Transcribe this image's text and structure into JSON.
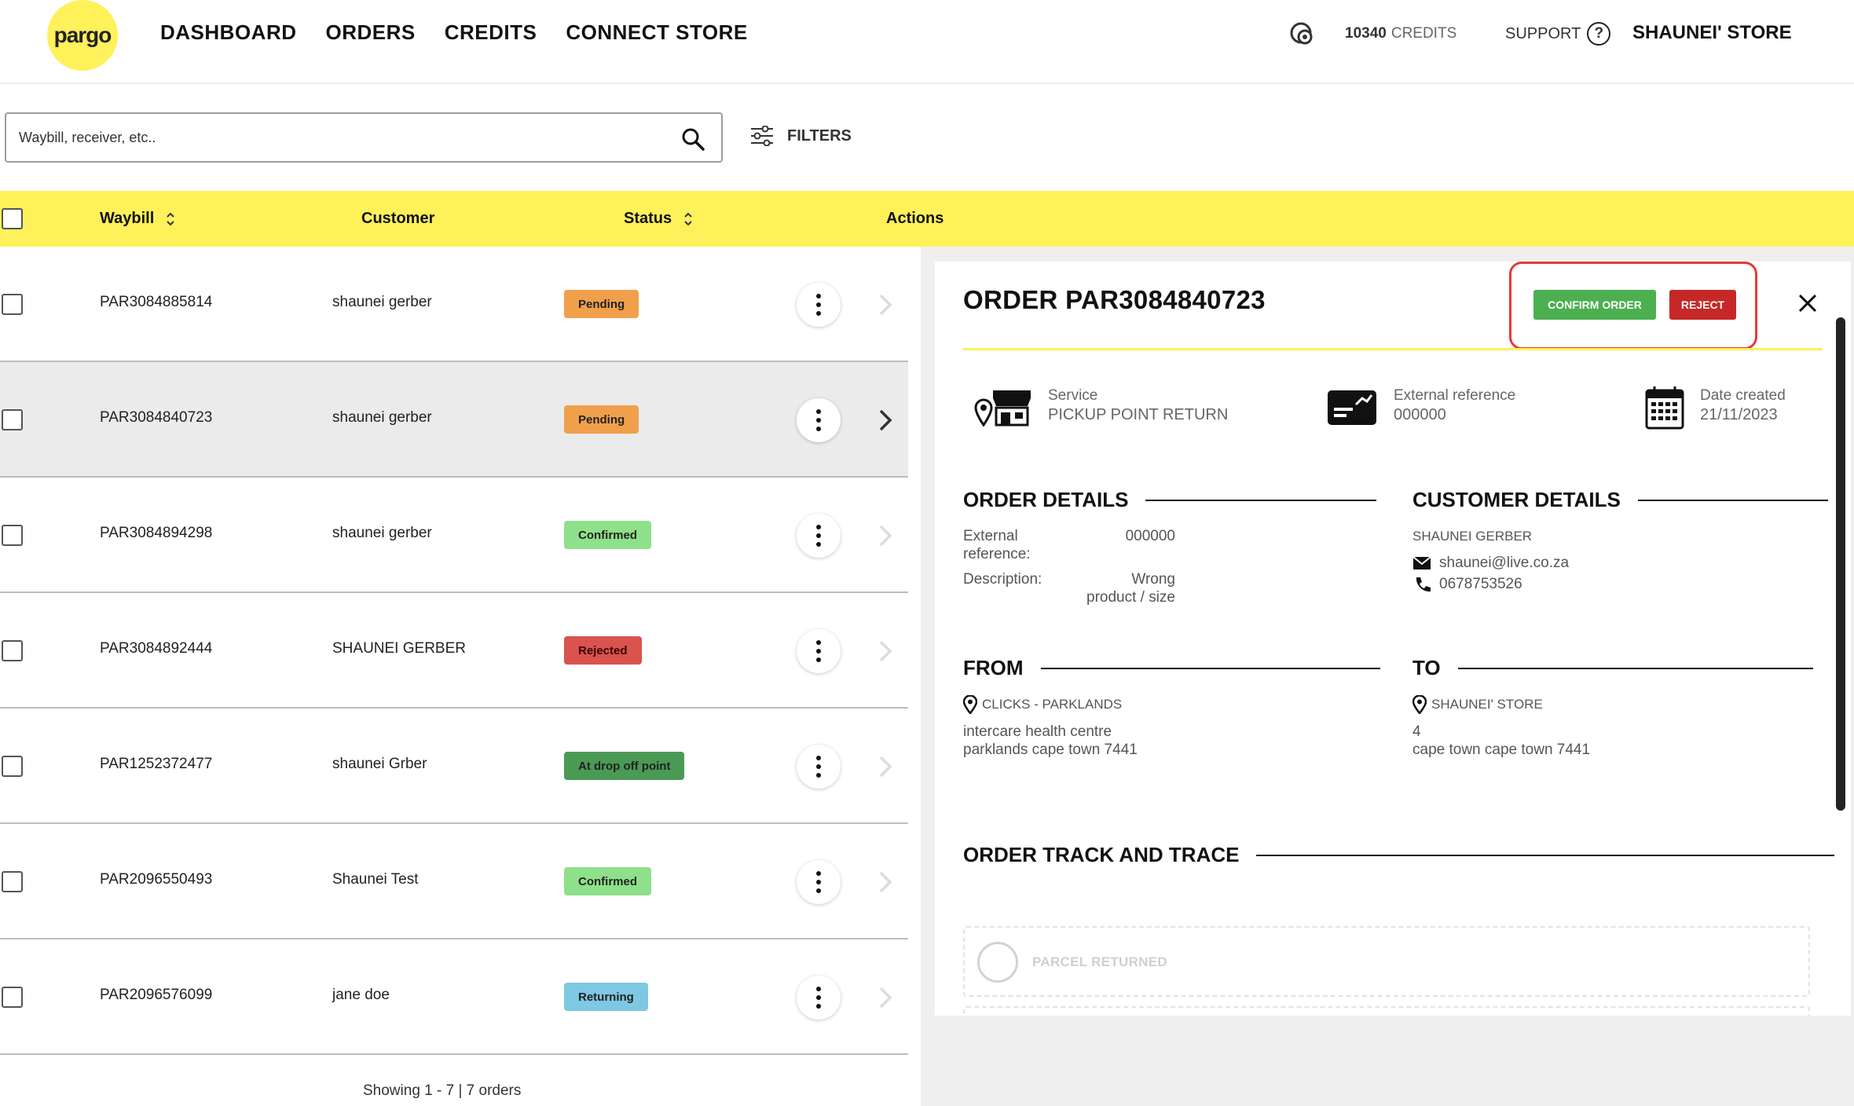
{
  "header": {
    "logo_text": "pargo",
    "nav": [
      "DASHBOARD",
      "ORDERS",
      "CREDITS",
      "CONNECT STORE"
    ],
    "credits_value": "10340",
    "credits_label": "CREDITS",
    "support_label": "SUPPORT",
    "store_name": "SHAUNEI' STORE",
    "brand_color": "#fff15a"
  },
  "search": {
    "placeholder": "Waybill, receiver, etc..",
    "filters_label": "FILTERS"
  },
  "table": {
    "columns": {
      "waybill": "Waybill",
      "customer": "Customer",
      "status": "Status",
      "actions": "Actions"
    },
    "rows": [
      {
        "waybill": "PAR3084885814",
        "customer": "shaunei gerber",
        "status": "Pending",
        "status_color": "#f0a04b",
        "selected": false
      },
      {
        "waybill": "PAR3084840723",
        "customer": "shaunei gerber",
        "status": "Pending",
        "status_color": "#f0a04b",
        "selected": true
      },
      {
        "waybill": "PAR3084894298",
        "customer": "shaunei gerber",
        "status": "Confirmed",
        "status_color": "#8fe08a",
        "selected": false
      },
      {
        "waybill": "PAR3084892444",
        "customer": "SHAUNEI GERBER",
        "status": "Rejected",
        "status_color": "#d9534f",
        "selected": false
      },
      {
        "waybill": "PAR1252372477",
        "customer": "shaunei Grber",
        "status": "At drop off point",
        "status_color": "#4a9a55",
        "selected": false
      },
      {
        "waybill": "PAR2096550493",
        "customer": "Shaunei Test",
        "status": "Confirmed",
        "status_color": "#8fe08a",
        "selected": false
      },
      {
        "waybill": "PAR2096576099",
        "customer": "jane doe",
        "status": "Returning",
        "status_color": "#7ec8e3",
        "selected": false
      }
    ],
    "footer": "Showing 1 - 7 | 7 orders"
  },
  "detail": {
    "title": "ORDER PAR3084840723",
    "confirm_label": "CONFIRM ORDER",
    "reject_label": "REJECT",
    "service_label": "Service",
    "service_value": "PICKUP POINT RETURN",
    "extref_label": "External reference",
    "extref_value": "000000",
    "date_label": "Date created",
    "date_value": "21/11/2023",
    "order_details": {
      "heading": "ORDER DETAILS",
      "extref_key_1": "External",
      "extref_key_2": "reference:",
      "extref_val": "000000",
      "desc_key": "Description:",
      "desc_val_1": "Wrong",
      "desc_val_2": "product / size"
    },
    "customer_details": {
      "heading": "CUSTOMER DETAILS",
      "name": "SHAUNEI GERBER",
      "email": "shaunei@live.co.za",
      "phone": "0678753526"
    },
    "from": {
      "heading": "FROM",
      "name": "CLICKS - PARKLANDS",
      "line1": "intercare health centre",
      "line2": "parklands cape town 7441"
    },
    "to": {
      "heading": "TO",
      "name": "SHAUNEI' STORE",
      "line1": "4",
      "line2": "cape town cape town 7441"
    },
    "track": {
      "heading": "ORDER TRACK AND TRACE",
      "step1": "PARCEL RETURNED"
    }
  }
}
